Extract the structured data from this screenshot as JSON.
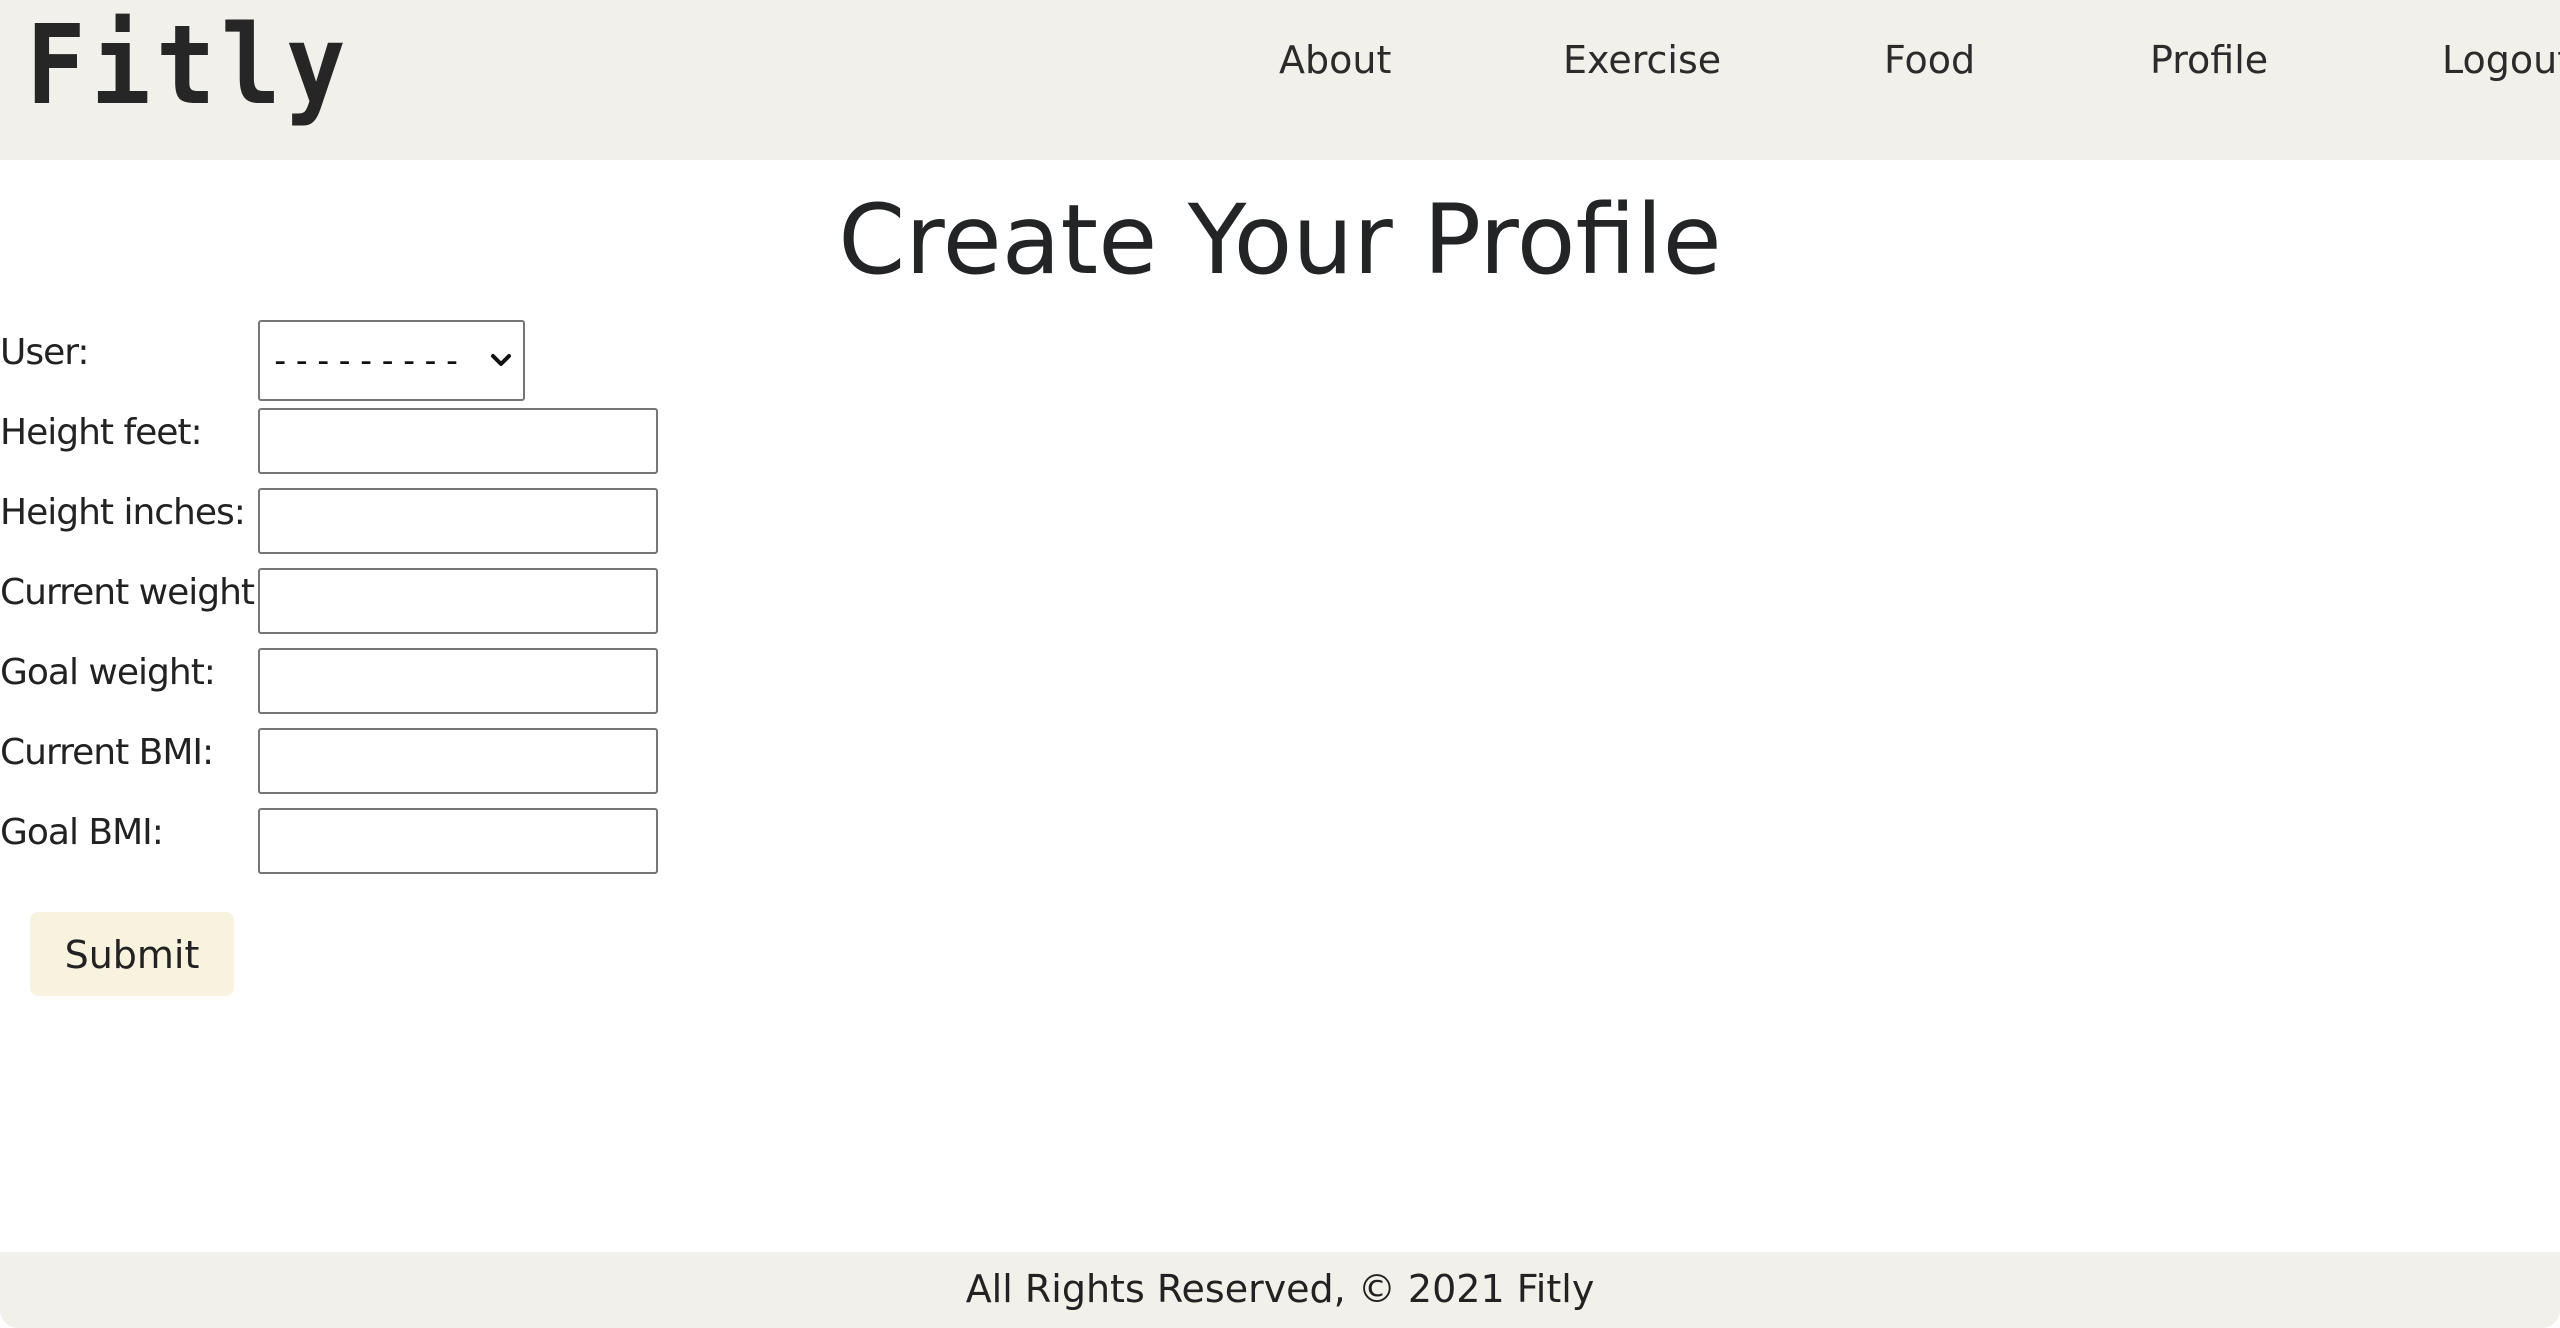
{
  "header": {
    "logo_text": "Fitly",
    "nav": {
      "about": "About",
      "exercise": "Exercise",
      "food": "Food",
      "profile": "Profile",
      "logout": "Logout"
    }
  },
  "main": {
    "title": "Create Your Profile",
    "form": {
      "user_label": "User:",
      "user_selected": "---------",
      "height_feet_label": "Height feet:",
      "height_feet_value": "",
      "height_inches_label": "Height inches:",
      "height_inches_value": "",
      "current_weight_label": "Current weight:",
      "current_weight_value": "",
      "goal_weight_label": "Goal weight:",
      "goal_weight_value": "",
      "current_bmi_label": "Current BMI:",
      "current_bmi_value": "",
      "goal_bmi_label": "Goal BMI:",
      "goal_bmi_value": "",
      "submit_label": "Submit"
    }
  },
  "footer": {
    "text": "All Rights Reserved, © 2021 Fitly"
  },
  "colors": {
    "header_bg": "#f2f0eb",
    "footer_bg": "#f2f0eb",
    "submit_bg": "#f7f3df",
    "text": "#222222"
  },
  "icons": {
    "select_arrow": "chevron-down-icon"
  }
}
